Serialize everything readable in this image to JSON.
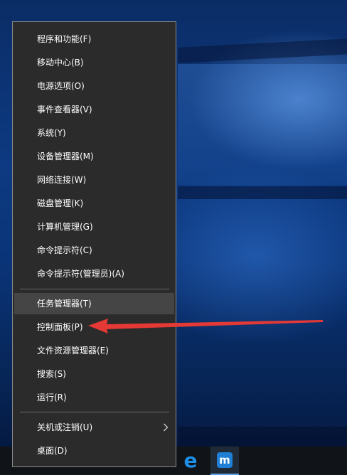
{
  "menu": {
    "items": [
      {
        "label": "程序和功能(F)"
      },
      {
        "label": "移动中心(B)"
      },
      {
        "label": "电源选项(O)"
      },
      {
        "label": "事件查看器(V)"
      },
      {
        "label": "系统(Y)"
      },
      {
        "label": "设备管理器(M)"
      },
      {
        "label": "网络连接(W)"
      },
      {
        "label": "磁盘管理(K)"
      },
      {
        "label": "计算机管理(G)"
      },
      {
        "label": "命令提示符(C)"
      },
      {
        "label": "命令提示符(管理员)(A)"
      },
      {
        "label": "任务管理器(T)"
      },
      {
        "label": "控制面板(P)"
      },
      {
        "label": "文件资源管理器(E)"
      },
      {
        "label": "搜索(S)"
      },
      {
        "label": "运行(R)"
      },
      {
        "label": "关机或注销(U)"
      },
      {
        "label": "桌面(D)"
      }
    ]
  },
  "colors": {
    "menu_background": "#2b2b2b",
    "menu_hover": "#454545",
    "annotation_arrow": "#e53935",
    "taskbar": "#101418"
  },
  "icons": {
    "submenu": "chevron-right-icon",
    "edge": "edge-browser-icon",
    "maxthon": "maxthon-browser-icon"
  }
}
